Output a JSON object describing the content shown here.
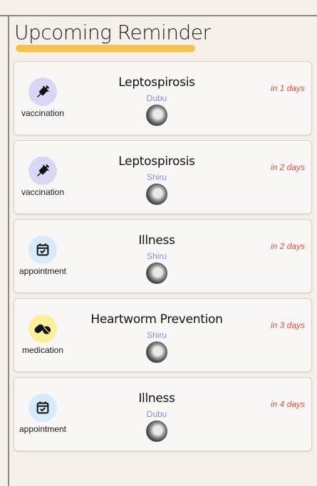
{
  "header": {
    "title": "Upcoming Reminder"
  },
  "colors": {
    "accent_underline": "#f7c24b",
    "due_text": "#e2543e",
    "pet_name": "#8a8bdc"
  },
  "reminders": [
    {
      "title": "Leptospirosis",
      "type": "vaccination",
      "type_icon": "syringe-icon",
      "pet": "Dubu",
      "due": "in 1 days"
    },
    {
      "title": "Leptospirosis",
      "type": "vaccination",
      "type_icon": "syringe-icon",
      "pet": "Shiru",
      "due": "in 2 days"
    },
    {
      "title": "Illness",
      "type": "appointment",
      "type_icon": "calendar-check-icon",
      "pet": "Shiru",
      "due": "in 2 days"
    },
    {
      "title": "Heartworm Prevention",
      "type": "medication",
      "type_icon": "pills-icon",
      "pet": "Shiru",
      "due": "in 3 days"
    },
    {
      "title": "Illness",
      "type": "appointment",
      "type_icon": "calendar-check-icon",
      "pet": "Dubu",
      "due": "in 4 days"
    }
  ]
}
